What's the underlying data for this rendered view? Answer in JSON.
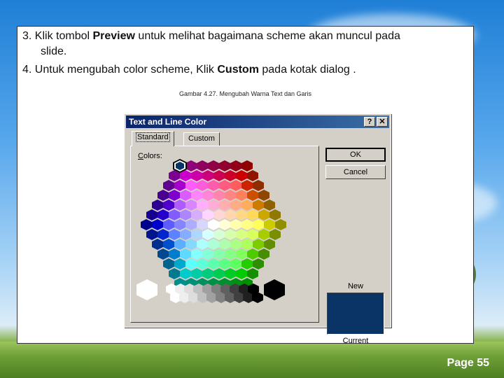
{
  "slide": {
    "bullet3_prefix": "3. Klik tombol ",
    "bullet3_bold": "Preview",
    "bullet3_rest": " untuk melihat bagaimana scheme akan muncul pada",
    "bullet3_cont": "slide.",
    "bullet4_prefix": "4. Untuk mengubah color scheme, Klik ",
    "bullet4_bold": "Custom",
    "bullet4_rest": " pada kotak dialog .",
    "caption": "Gambar 4.27. Mengubah Warna Text dan Garis",
    "page_label": "Page 55"
  },
  "dialog": {
    "title": "Text and Line Color",
    "help_btn": "?",
    "close_btn": "✕",
    "tabs": [
      {
        "label": "Standard",
        "active": true
      },
      {
        "label": "Custom",
        "active": false
      }
    ],
    "colors_label_u": "C",
    "colors_label_rest": "olors:",
    "ok_label": "OK",
    "cancel_label": "Cancel",
    "new_label": "New",
    "current_label": "Current",
    "preview_color": "#0a3366"
  },
  "colors": {
    "title_bar_start": "#0a246a",
    "title_bar_end": "#3a6ea5",
    "dialog_face": "#d4d0c8"
  }
}
